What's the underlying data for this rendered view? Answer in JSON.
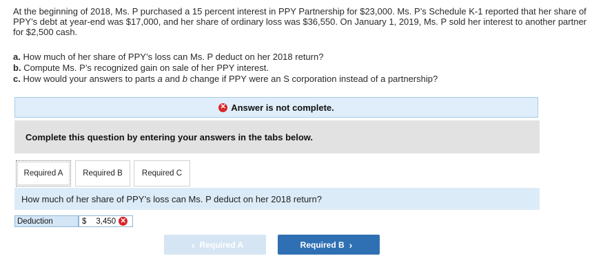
{
  "intro": "At the beginning of 2018, Ms. P purchased a 15 percent interest in PPY Partnership for $23,000. Ms. P’s Schedule K-1 reported that her share of PPY’s debt at year-end was $17,000, and her share of ordinary loss was $36,550. On January 1, 2019, Ms. P sold her interest to another partner for $2,500 cash.",
  "questions": [
    {
      "letter": "a.",
      "text": "How much of her share of PPY’s loss can Ms. P deduct on her 2018 return?"
    },
    {
      "letter": "b.",
      "text": "Compute Ms. P’s recognized gain on sale of her PPY interest."
    },
    {
      "letter": "c.",
      "text_pre": "How would your answers to parts ",
      "italic_a": "a",
      "text_mid": " and ",
      "italic_b": "b",
      "text_post": " change if PPY were an S corporation instead of a partnership?"
    }
  ],
  "status": {
    "text": "Answer is not complete.",
    "icon": "x-circle-icon",
    "color": "#d9262b"
  },
  "instructions": "Complete this question by entering your answers in the tabs below.",
  "tabs": [
    {
      "label": "Required A",
      "active": true
    },
    {
      "label": "Required B",
      "active": false
    },
    {
      "label": "Required C",
      "active": false
    }
  ],
  "current_question": "How much of her share of PPY’s loss can Ms. P deduct on her 2018 return?",
  "answer_row": {
    "label": "Deduction",
    "currency": "$",
    "value": "3,450",
    "status_icon": "x-circle-icon"
  },
  "nav": {
    "prev_label": "Required A",
    "next_label": "Required B"
  },
  "colors": {
    "accent": "#2f6fb3",
    "error": "#d9262b",
    "panel_blue": "#dfeefa",
    "panel_gray": "#e2e2e2"
  }
}
